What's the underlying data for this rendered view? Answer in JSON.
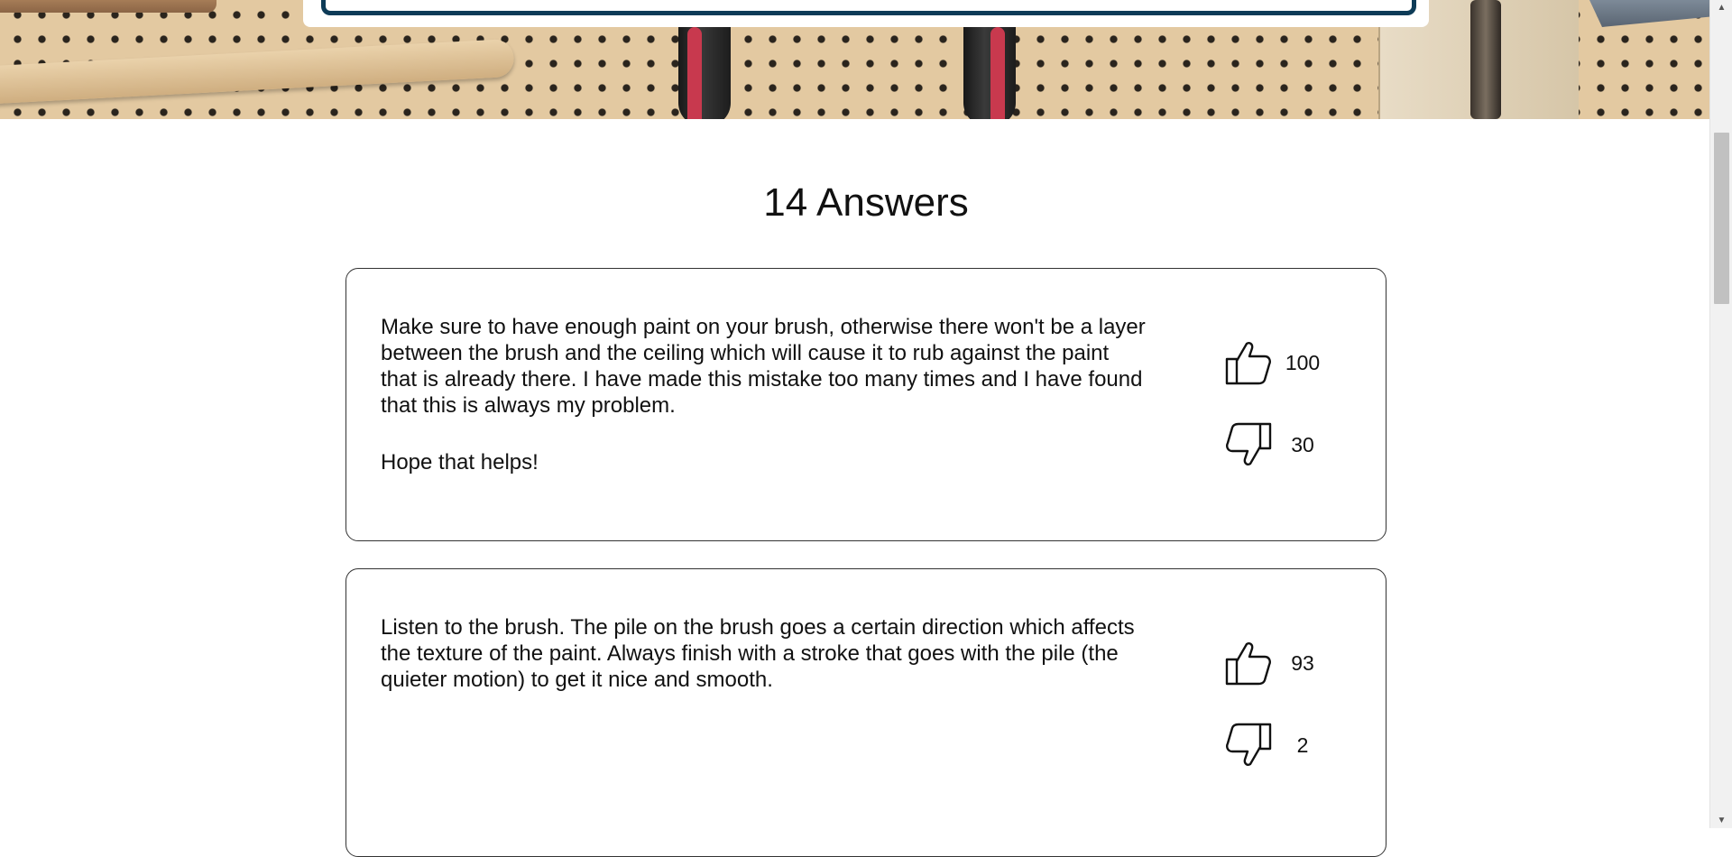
{
  "answers_section": {
    "heading": "14 Answers",
    "answers": [
      {
        "paragraphs": [
          "Make sure to have enough paint on your brush, otherwise there won't be a layer between the brush and the ceiling which will cause it to rub against the paint that is already there. I have made this mistake too many times and I have found that this is always my problem.",
          "Hope that helps!"
        ],
        "upvotes": "100",
        "downvotes": "30"
      },
      {
        "paragraphs": [
          "Listen to the brush. The pile on the brush goes a certain direction which affects the texture of the paint. Always finish with a stroke that goes with the pile (the quieter motion) to get it nice and smooth."
        ],
        "upvotes": "93",
        "downvotes": "2"
      }
    ]
  },
  "icons": {
    "upvote": "thumbs-up-icon",
    "downvote": "thumbs-down-icon"
  },
  "colors": {
    "search_border": "#0d3b57",
    "pegboard": "#e3c9a1"
  }
}
